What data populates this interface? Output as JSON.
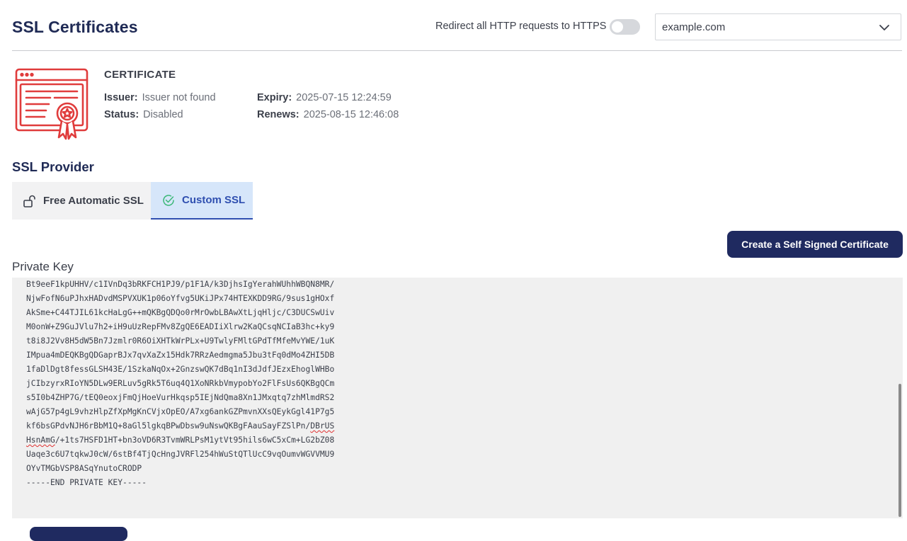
{
  "header": {
    "title": "SSL Certificates",
    "redirect_label": "Redirect all HTTP requests to HTTPS",
    "redirect_enabled": false,
    "domain_selected": "example.com"
  },
  "certificate": {
    "heading": "CERTIFICATE",
    "issuer_label": "Issuer:",
    "issuer_value": "Issuer not found",
    "status_label": "Status:",
    "status_value": "Disabled",
    "expiry_label": "Expiry:",
    "expiry_value": "2025-07-15 12:24:59",
    "renews_label": "Renews:",
    "renews_value": "2025-08-15 12:46:08",
    "icon": "certificate-icon",
    "icon_color": "#e03c3c"
  },
  "provider": {
    "title": "SSL Provider",
    "tabs": [
      {
        "label": "Free Automatic SSL",
        "icon": "unlock-icon",
        "active": false
      },
      {
        "label": "Custom SSL",
        "icon": "check-circle-icon",
        "active": true
      }
    ]
  },
  "actions": {
    "create_self_signed": "Create a Self Signed Certificate"
  },
  "private_key": {
    "label": "Private Key",
    "lines": [
      "Bt9eeF1kpUHHV/c1IVnDq3bRKFCH1PJ9/p1F1A/k3DjhsIgYerahWUhhWBQN8MR/",
      "NjwFofN6uPJhxHADvdMSPVXUK1p06oYfvg5UKiJPx74HTEXKDD9RG/9sus1gHOxf",
      "AkSme+C44TJIL61kcHaLgG++mQKBgQDQo0rMrOwbLBAwXtLjqHljc/C3DUCSwUiv",
      "M0onW+Z9GuJVlu7h2+iH9uUzRepFMv8ZgQE6EADIiXlrw2KaQCsqNCIaB3hc+ky9",
      "t8i8J2Vv8H5dW5Bn7Jzmlr0R6OiXHTkWrPLx+U9TwlyFMltGPdTfMfeMvYWE/1uK",
      "IMpua4mDEQKBgQDGaprBJx7qvXaZx15Hdk7RRzAedmgma5Jbu3tFq0dMo4ZHI5DB",
      "1faDlDgt8fessGLSH43E/1SzkaNqOx+2GnzswQK7dBq1nI3dJdfJEzxEhoglWHBo",
      "jCIbzyrxRIoYN5DLw9ERLuv5gRk5T6uq4Q1XoNRkbVmypobYo2FlFsUs6QKBgQCm",
      "s5I0b4ZHP7G/tEQ0eoxjFmQjHoeVurHkqsp5IEjNdQma8Xn1JMxqtq7zhMlmdRS2",
      "wAjG57p4gL9vhzHlpZfXpMgKnCVjxOpEO/A7xg6ankGZPmvnXXsQEykGgl41P7g5",
      "kf6bsGPdvNJH6rBbM1Q+8aGl5lgkqBPwDbsw9uNswQKBgFAauSayFZSlPn/",
      "HsnAmG/+1ts7HSFD1HT+bn3oVD6R3TvmWRLPsM1ytVt95hils6wC5xCm+LG2bZ08",
      "Uaqe3c6U7tqkwJ0cW/6stBf4TjQcHngJVRFl254hWuStQTlUcC9vqOumvWGVVMU9",
      "OYvTMGbVSP8ASqYnutoCRODP",
      "-----END PRIVATE KEY-----"
    ],
    "line11_tail": "DBrUS",
    "line12_head": "HsnAmG",
    "line12_rest": "/+1ts7HSFD1HT+bn3oVD6R3TvmWRLPsM1ytVt95hils6wC5xCm+LG2bZ08"
  },
  "colors": {
    "brand_navy": "#1f2a60",
    "tab_active_bg": "#d6e6fa",
    "tab_active_text": "#2f4fb0",
    "check_green": "#3cb878"
  }
}
